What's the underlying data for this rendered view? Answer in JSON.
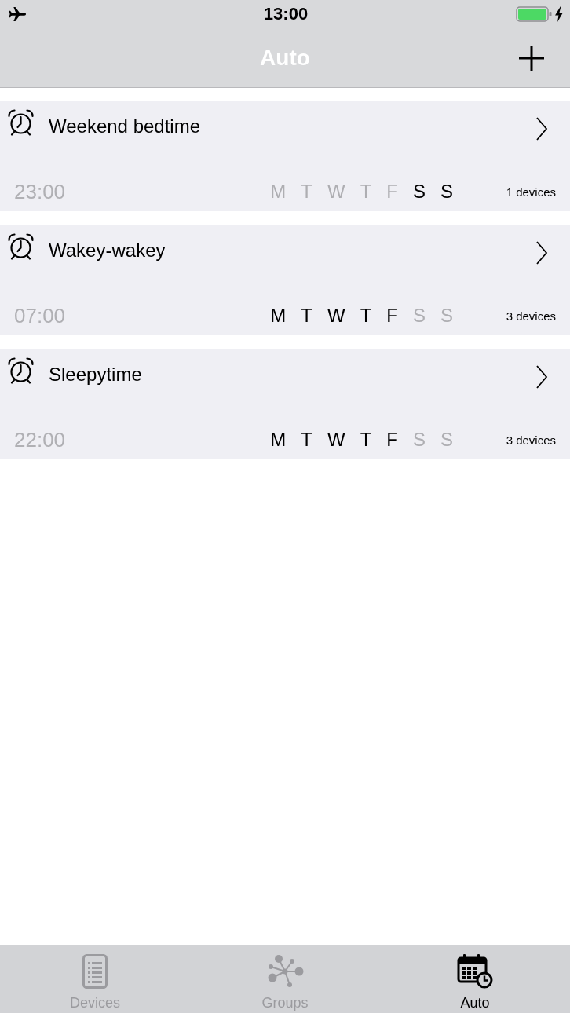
{
  "status_bar": {
    "time": "13:00"
  },
  "nav_bar": {
    "title": "Auto"
  },
  "automations": [
    {
      "name": "Weekend bedtime",
      "time": "23:00",
      "days": [
        {
          "label": "M",
          "on": false
        },
        {
          "label": "T",
          "on": false
        },
        {
          "label": "W",
          "on": false
        },
        {
          "label": "T",
          "on": false
        },
        {
          "label": "F",
          "on": false
        },
        {
          "label": "S",
          "on": true
        },
        {
          "label": "S",
          "on": true
        }
      ],
      "devices": "1 devices"
    },
    {
      "name": "Wakey-wakey",
      "time": "07:00",
      "days": [
        {
          "label": "M",
          "on": true
        },
        {
          "label": "T",
          "on": true
        },
        {
          "label": "W",
          "on": true
        },
        {
          "label": "T",
          "on": true
        },
        {
          "label": "F",
          "on": true
        },
        {
          "label": "S",
          "on": false
        },
        {
          "label": "S",
          "on": false
        }
      ],
      "devices": "3 devices"
    },
    {
      "name": "Sleepytime",
      "time": "22:00",
      "days": [
        {
          "label": "M",
          "on": true
        },
        {
          "label": "T",
          "on": true
        },
        {
          "label": "W",
          "on": true
        },
        {
          "label": "T",
          "on": true
        },
        {
          "label": "F",
          "on": true
        },
        {
          "label": "S",
          "on": false
        },
        {
          "label": "S",
          "on": false
        }
      ],
      "devices": "3 devices"
    }
  ],
  "tab_bar": {
    "tabs": [
      {
        "label": "Devices",
        "kind": "list",
        "selected": false
      },
      {
        "label": "Groups",
        "kind": "nodes",
        "selected": false
      },
      {
        "label": "Auto",
        "kind": "calendar",
        "selected": true
      }
    ]
  }
}
